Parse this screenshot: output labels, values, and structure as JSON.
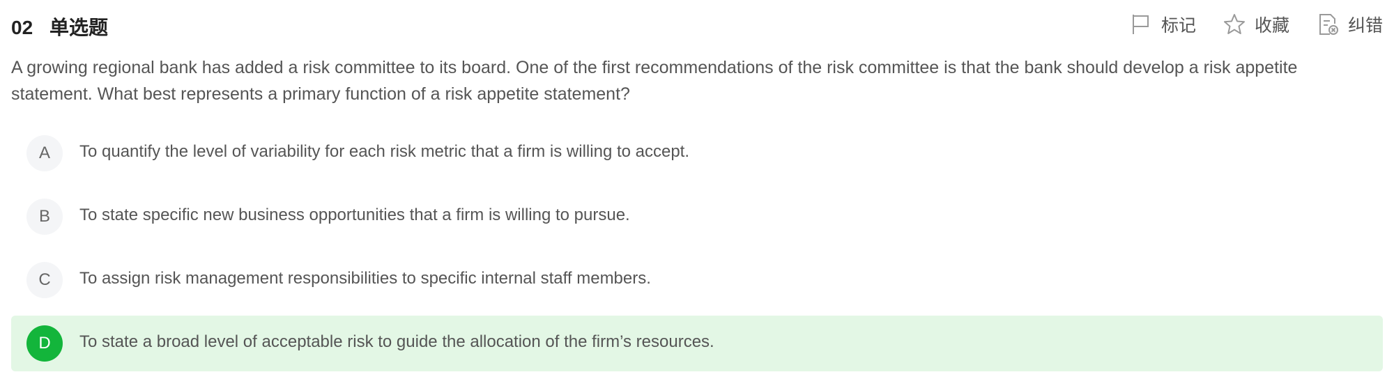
{
  "header": {
    "number": "02",
    "type": "单选题",
    "actions": [
      {
        "label": "标记",
        "icon": "flag-icon"
      },
      {
        "label": "收藏",
        "icon": "star-icon"
      },
      {
        "label": "纠错",
        "icon": "report-error-icon"
      }
    ]
  },
  "question": {
    "text": "A growing regional bank has added a risk committee to its board. One of the first recommendations of the risk committee is that the bank should develop a risk appetite statement. What best represents a primary function of a risk appetite statement?"
  },
  "options": [
    {
      "letter": "A",
      "text": "To quantify the level of variability for each risk metric that a firm is willing to accept."
    },
    {
      "letter": "B",
      "text": "To state specific new business opportunities that a firm is willing to pursue."
    },
    {
      "letter": "C",
      "text": "To assign risk management responsibilities to specific internal staff members."
    },
    {
      "letter": "D",
      "text": "To state a broad level of acceptable risk to guide the allocation of the firm’s resources."
    }
  ],
  "correct_option": "D",
  "colors": {
    "correct_bg": "#e3f7e5",
    "correct_badge": "#13b53b",
    "badge_bg": "#f4f5f7"
  }
}
